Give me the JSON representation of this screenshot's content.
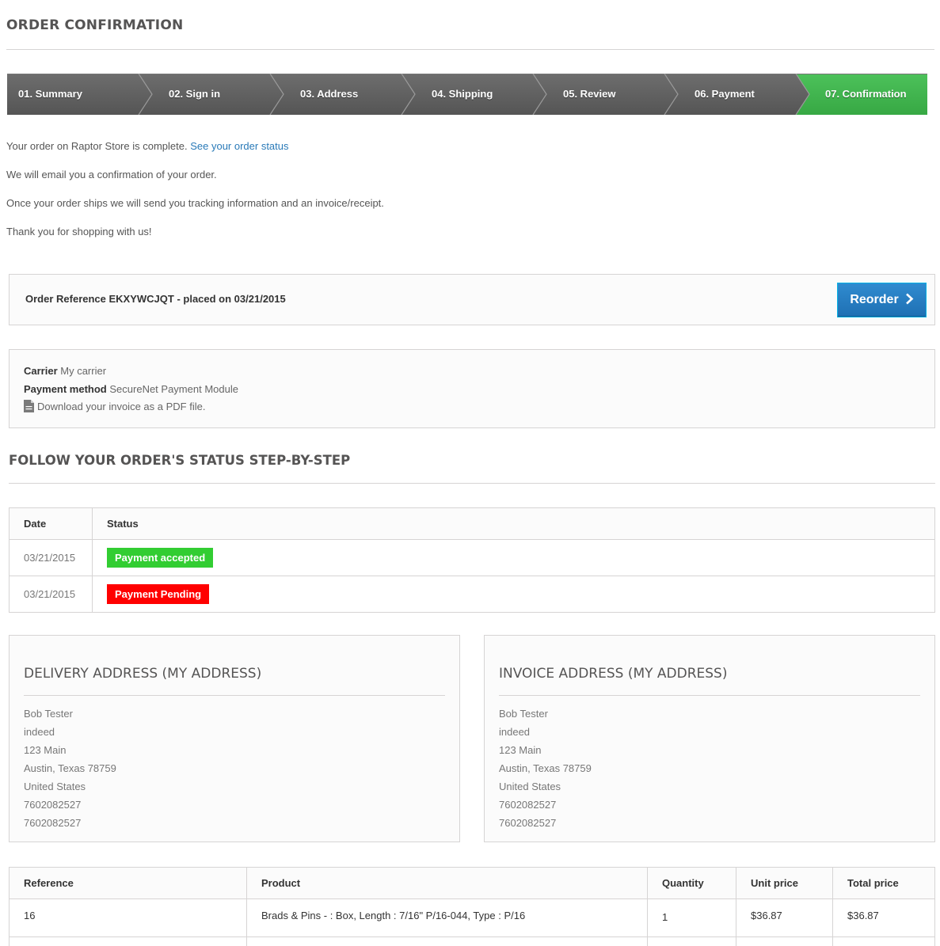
{
  "page_title": "ORDER CONFIRMATION",
  "steps": [
    {
      "label": "01. Summary",
      "active": false
    },
    {
      "label": "02. Sign in",
      "active": false
    },
    {
      "label": "03. Address",
      "active": false
    },
    {
      "label": "04. Shipping",
      "active": false
    },
    {
      "label": "05. Review",
      "active": false
    },
    {
      "label": "06. Payment",
      "active": false
    },
    {
      "label": "07. Confirmation",
      "active": true
    }
  ],
  "messages": {
    "complete": "Your order on Raptor Store is complete.",
    "status_link": "See your order status",
    "email": "We will email you a confirmation of your order.",
    "ships": "Once your order ships we will send you tracking information and an invoice/receipt.",
    "thanks": "Thank you for shopping with us!"
  },
  "order": {
    "reference_text": "Order Reference EKXYWCJQT - placed on 03/21/2015",
    "reorder_label": "Reorder",
    "carrier_label": "Carrier",
    "carrier_value": "My carrier",
    "payment_label": "Payment method",
    "payment_value": "SecureNet Payment Module",
    "invoice_link": "Download your invoice as a PDF file."
  },
  "status_section": {
    "title": "FOLLOW YOUR ORDER'S STATUS STEP-BY-STEP",
    "headers": [
      "Date",
      "Status"
    ],
    "rows": [
      {
        "date": "03/21/2015",
        "status": "Payment accepted",
        "color": "#32cd32"
      },
      {
        "date": "03/21/2015",
        "status": "Payment Pending",
        "color": "#ff0000"
      }
    ]
  },
  "delivery_address": {
    "title": "DELIVERY ADDRESS (MY ADDRESS)",
    "lines": [
      "Bob Tester",
      "indeed",
      "123 Main",
      "Austin, Texas 78759",
      "United States",
      "7602082527",
      "7602082527"
    ]
  },
  "invoice_address": {
    "title": "INVOICE ADDRESS (MY ADDRESS)",
    "lines": [
      "Bob Tester",
      "indeed",
      "123 Main",
      "Austin, Texas 78759",
      "United States",
      "7602082527",
      "7602082527"
    ]
  },
  "products": {
    "headers": [
      "Reference",
      "Product",
      "Quantity",
      "Unit price",
      "Total price"
    ],
    "rows": [
      {
        "reference": "16",
        "product": "Brads & Pins - : Box, Length : 7/16\" P/16-044, Type : P/16",
        "quantity": "1",
        "unit_price": "$36.87",
        "total_price": "$36.87"
      }
    ]
  }
}
